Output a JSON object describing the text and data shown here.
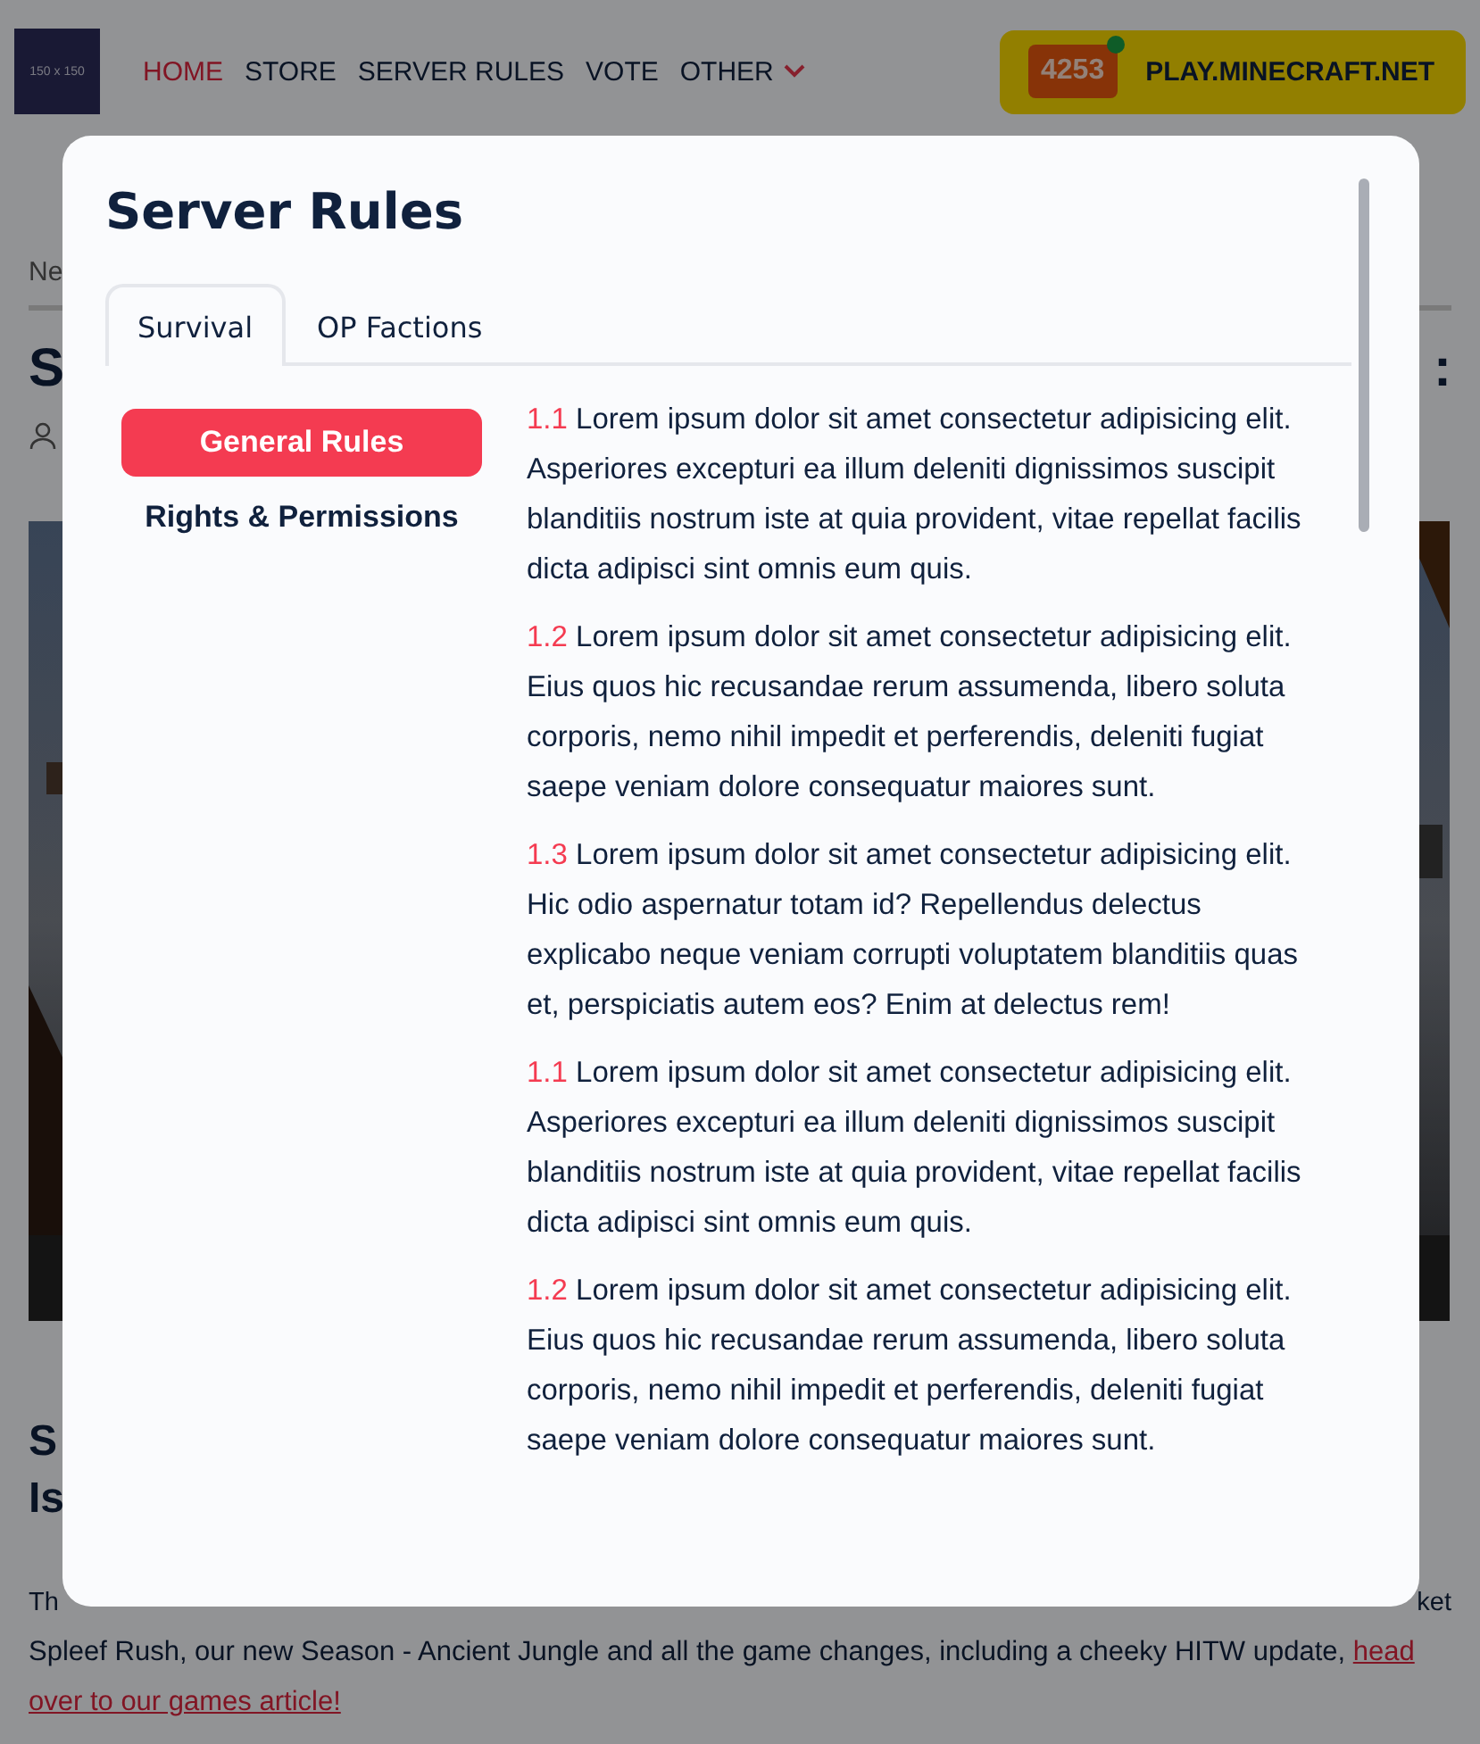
{
  "header": {
    "logo": "150 x 150",
    "nav": [
      {
        "label": "HOME",
        "selected": true,
        "kind": "link"
      },
      {
        "label": "STORE",
        "selected": false,
        "kind": "link"
      },
      {
        "label": "SERVER RULES",
        "selected": false,
        "kind": "link"
      },
      {
        "label": "VOTE",
        "selected": false,
        "kind": "link"
      },
      {
        "label": "OTHER",
        "selected": false,
        "kind": "dropdown"
      }
    ],
    "server": {
      "player_count": "4253",
      "online": true,
      "address": "PLAY.MINECRAFT.NET"
    }
  },
  "article": {
    "breadcrumb": "Ne",
    "title_start": "S",
    "title_end": ":",
    "heading_lines": [
      "S",
      "Is"
    ],
    "intro_start": "Th",
    "intro_end": "ket",
    "intro_line": "Spleef Rush, our new Season - Ancient Jungle and all the game changes, including a cheeky HITW update,",
    "intro_link_lines": [
      "head",
      "over to our games article!"
    ]
  },
  "modal": {
    "title": "Server Rules",
    "tabs": [
      {
        "label": "Survival",
        "selected": true
      },
      {
        "label": "OP Factions",
        "selected": false
      }
    ],
    "sections": [
      {
        "label": "General Rules",
        "selected": true
      },
      {
        "label": "Rights & Permissions",
        "selected": false
      }
    ],
    "rules": [
      {
        "number": "1.1",
        "text": "Lorem ipsum dolor sit amet consectetur adipisicing elit. Asperiores excepturi ea illum deleniti dignissimos suscipit blanditiis nostrum iste at quia provident, vitae repellat facilis dicta adipisci sint omnis eum quis."
      },
      {
        "number": "1.2",
        "text": "Lorem ipsum dolor sit amet consectetur adipisicing elit. Eius quos hic recusandae rerum assumenda, libero soluta corporis, nemo nihil impedit et perferendis, deleniti fugiat saepe veniam dolore consequatur maiores sunt."
      },
      {
        "number": "1.3",
        "text": "Lorem ipsum dolor sit amet consectetur adipisicing elit. Hic odio aspernatur totam id? Repellendus delectus explicabo neque veniam corrupti voluptatem blanditiis quas et, perspiciatis autem eos? Enim at delectus rem!"
      },
      {
        "number": "1.1",
        "text": "Lorem ipsum dolor sit amet consectetur adipisicing elit. Asperiores excepturi ea illum deleniti dignissimos suscipit blanditiis nostrum iste at quia provident, vitae repellat facilis dicta adipisci sint omnis eum quis."
      },
      {
        "number": "1.2",
        "text": "Lorem ipsum dolor sit amet consectetur adipisicing elit. Eius quos hic recusandae rerum assumenda, libero soluta corporis, nemo nihil impedit et perferendis, deleniti fugiat saepe veniam dolore consequatur maiores sunt."
      }
    ]
  }
}
